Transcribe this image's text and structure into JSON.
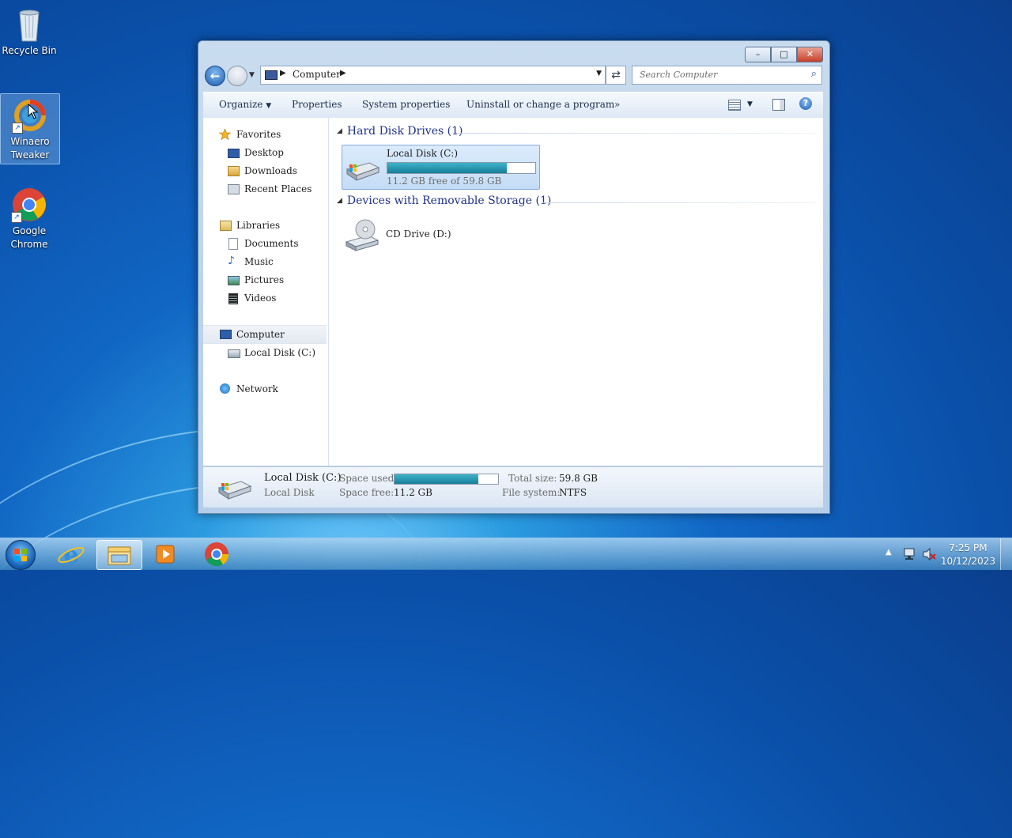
{
  "desktop": {
    "icons": [
      {
        "label": "Recycle Bin"
      },
      {
        "label": "Winaero Tweaker"
      },
      {
        "label": "Google Chrome"
      }
    ]
  },
  "window": {
    "caption_buttons": {
      "minimize": "–",
      "maximize": "□",
      "close": "✕"
    },
    "address": {
      "crumb": "Computer"
    },
    "search": {
      "placeholder": "Search Computer"
    },
    "toolbar": {
      "organize": "Organize",
      "properties": "Properties",
      "system_properties": "System properties",
      "uninstall": "Uninstall or change a program",
      "more": "»"
    },
    "nav": {
      "favorites": "Favorites",
      "desktop": "Desktop",
      "downloads": "Downloads",
      "recent_places": "Recent Places",
      "libraries": "Libraries",
      "documents": "Documents",
      "music": "Music",
      "pictures": "Pictures",
      "videos": "Videos",
      "computer": "Computer",
      "local_disk": "Local Disk (C:)",
      "network": "Network"
    },
    "groups": {
      "hard_disk": "Hard Disk Drives (1)",
      "removable": "Devices with Removable Storage (1)"
    },
    "drives": {
      "c": {
        "name": "Local Disk (C:)",
        "free": "11.2 GB free of 59.8 GB",
        "used_fraction": 0.81
      },
      "d": {
        "name": "CD Drive (D:)"
      }
    },
    "details": {
      "name": "Local Disk (C:)",
      "type": "Local Disk",
      "space_used_label": "Space used:",
      "space_free_label": "Space free:",
      "space_free": "11.2 GB",
      "total_size_label": "Total size:",
      "total_size": "59.8 GB",
      "file_system_label": "File system:",
      "file_system": "NTFS"
    }
  },
  "taskbar": {
    "clock_time": "7:25 PM",
    "clock_date": "10/12/2023"
  },
  "colors": {
    "accent": "#1e3287",
    "bar_fill": "#167e99"
  }
}
